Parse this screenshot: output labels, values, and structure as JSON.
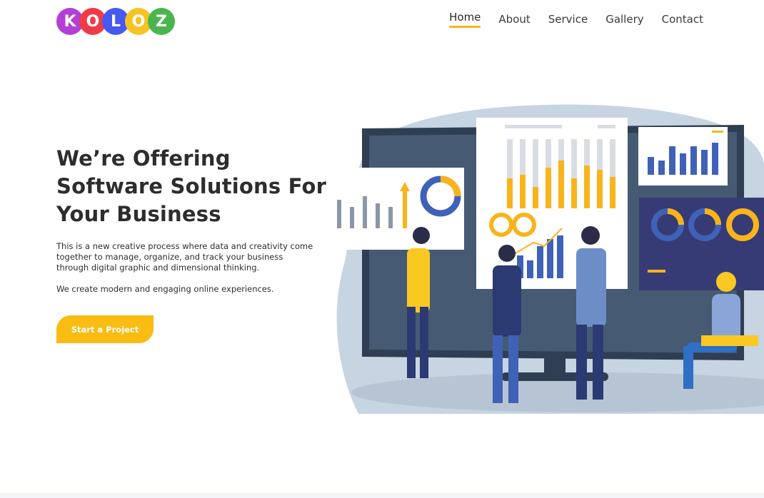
{
  "logo": {
    "letters": [
      "K",
      "O",
      "L",
      "O",
      "Z"
    ],
    "colors": [
      "#b23fd6",
      "#ef3b48",
      "#4659f0",
      "#f7c322",
      "#49b54e"
    ]
  },
  "nav": {
    "items": [
      "Home",
      "About",
      "Service",
      "Gallery",
      "Contact"
    ],
    "active": "Home",
    "accent": "#f9b41b"
  },
  "hero": {
    "title": "We’re Offering Software Solutions For Your Business",
    "description": "This is a new creative process where data and creativity come together to manage, organize, and track your business through digital graphic and dimensional thinking.",
    "subtext": "We create modern and engaging online experiences.",
    "cta_label": "Start a Project",
    "cta_color": "#f9bc13"
  },
  "illustration": {
    "icon": "business-analytics-illustration",
    "colors": {
      "backdrop": "#c7d4e2",
      "screen": "#2f3e52",
      "panel_dark": "#373b75",
      "accent_yellow": "#f9b41b",
      "accent_blue": "#3f62b8"
    }
  }
}
